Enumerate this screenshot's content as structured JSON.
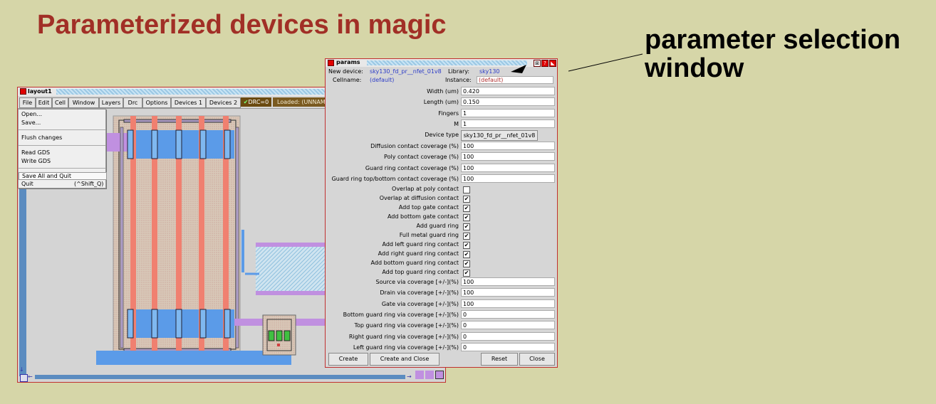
{
  "slide": {
    "title": "Parameterized devices in magic",
    "annotation_line1": "parameter selection",
    "annotation_line2": "window"
  },
  "layout_window": {
    "title": "layout1",
    "menu": [
      "File",
      "Edit",
      "Cell",
      "Window",
      "Layers",
      "Drc",
      "Options",
      "Devices 1",
      "Devices 2"
    ],
    "drc_status": "DRC=0",
    "loaded_text": "Loaded: (UNNAM",
    "file_menu": {
      "open": "Open...",
      "save": "Save...",
      "flush": "Flush changes",
      "read_gds": "Read GDS",
      "write_gds": "Write GDS",
      "save_all_quit": "Save All and Quit",
      "quit": "Quit",
      "quit_shortcut": "(^Shift_Q)"
    }
  },
  "params_window": {
    "title": "params",
    "new_device_label": "New device:",
    "new_device_value": "sky130_fd_pr__nfet_01v8",
    "library_label": "Library:",
    "library_value": "sky130",
    "cellname_label": "Cellname:",
    "cellname_value": "(default)",
    "instance_label": "Instance:",
    "instance_value": "(default)",
    "fields_top": [
      {
        "label": "Width (um)",
        "value": "0.420"
      },
      {
        "label": "Length (um)",
        "value": "0.150"
      },
      {
        "label": "Fingers",
        "value": "1"
      },
      {
        "label": "M",
        "value": "1"
      }
    ],
    "device_type_label": "Device type",
    "device_type_value": "sky130_fd_pr__nfet_01v8",
    "fields_coverage": [
      {
        "label": "Diffusion contact coverage (%)",
        "value": "100"
      },
      {
        "label": "Poly contact coverage (%)",
        "value": "100"
      },
      {
        "label": "Guard ring contact coverage (%)",
        "value": "100"
      },
      {
        "label": "Guard ring top/bottom contact coverage (%)",
        "value": "100"
      }
    ],
    "checkboxes": [
      {
        "label": "Overlap at poly contact",
        "checked": false,
        "mark": ""
      },
      {
        "label": "Overlap at diffusion contact",
        "checked": true,
        "mark": "✔"
      },
      {
        "label": "Add top gate contact",
        "checked": true,
        "mark": "✔"
      },
      {
        "label": "Add bottom gate contact",
        "checked": true,
        "mark": "✔"
      },
      {
        "label": "Add guard ring",
        "checked": true,
        "mark": "✔"
      },
      {
        "label": "Full metal guard ring",
        "checked": true,
        "mark": "✔"
      },
      {
        "label": "Add left guard ring contact",
        "checked": true,
        "mark": "✔"
      },
      {
        "label": "Add right guard ring contact",
        "checked": true,
        "mark": "✔"
      },
      {
        "label": "Add bottom guard ring contact",
        "checked": true,
        "mark": "✔"
      },
      {
        "label": "Add top guard ring contact",
        "checked": true,
        "mark": "✔"
      }
    ],
    "fields_via": [
      {
        "label": "Source via coverage [+/-](%)",
        "value": "100"
      },
      {
        "label": "Drain via coverage [+/-](%)",
        "value": "100"
      },
      {
        "label": "Gate via coverage [+/-](%)",
        "value": "100"
      },
      {
        "label": "Bottom guard ring via coverage [+/-](%)",
        "value": "0"
      },
      {
        "label": "Top guard ring via coverage [+/-](%)",
        "value": "0"
      },
      {
        "label": "Right guard ring via coverage [+/-](%)",
        "value": "0"
      },
      {
        "label": "Left guard ring via coverage [+/-](%)",
        "value": "0"
      }
    ],
    "buttons": {
      "create": "Create",
      "create_close": "Create and Close",
      "reset": "Reset",
      "close": "Close"
    }
  },
  "colors": {
    "background": "#d6d6a8",
    "title": "#a12f26",
    "scrollbar": "#5b8cc0",
    "poly": "#f08070",
    "diffusion": "#5b9be8",
    "local_interconnect": "#c080e0"
  }
}
